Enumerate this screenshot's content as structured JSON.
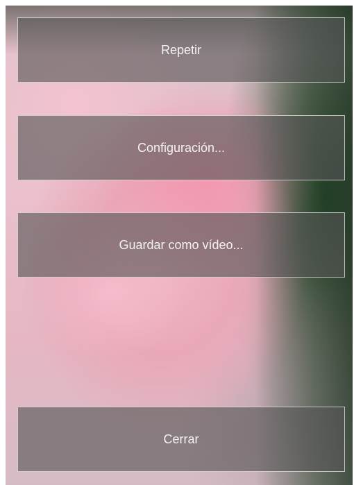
{
  "menu": {
    "repeat_label": "Repetir",
    "settings_label": "Configuración...",
    "save_video_label": "Guardar como vídeo...",
    "close_label": "Cerrar"
  },
  "colors": {
    "button_background": "#555555",
    "button_border": "#ebebeb",
    "button_text": "#f2f2f2"
  }
}
